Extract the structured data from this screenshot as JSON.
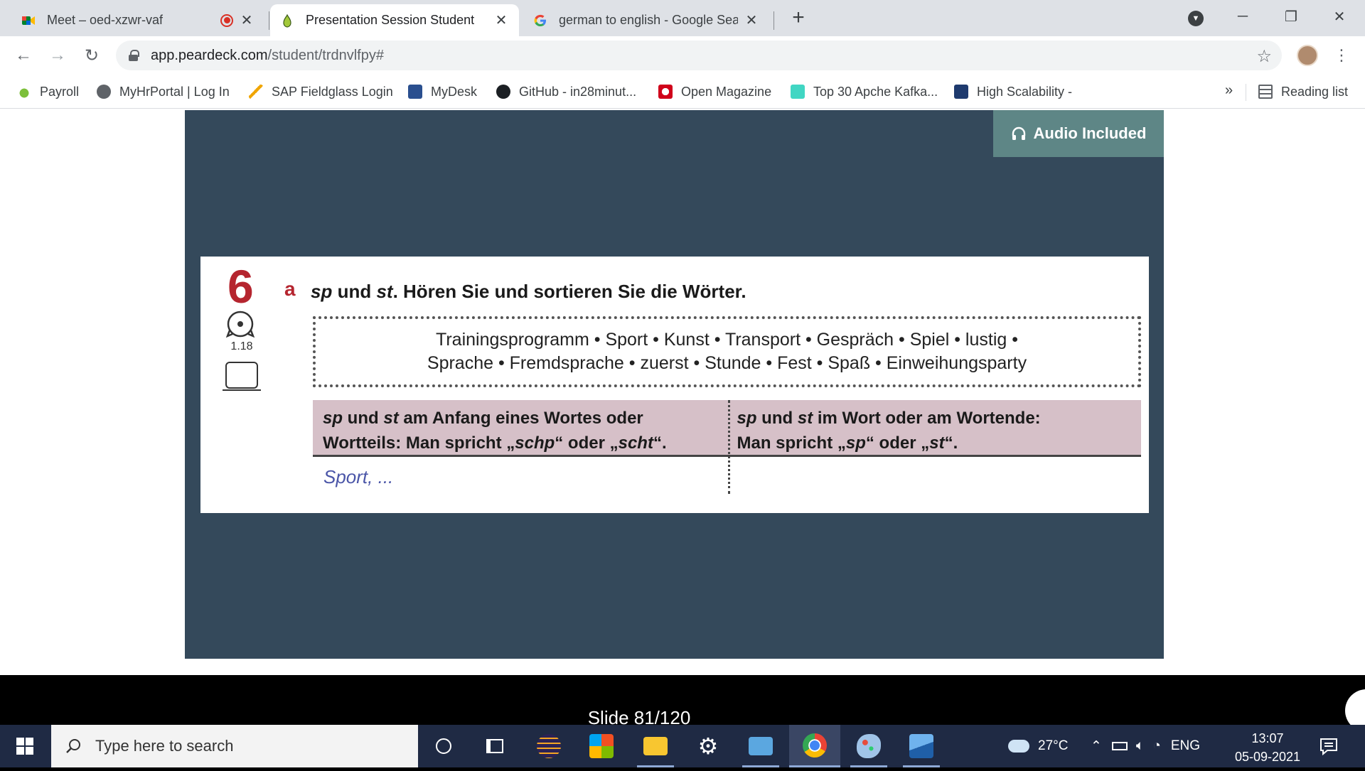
{
  "browser": {
    "tabs": [
      {
        "title": "Meet – oed-xzwr-vaf",
        "icon": "google-meet-icon",
        "recording": true
      },
      {
        "title": "Presentation Session Student",
        "icon": "peardeck-icon",
        "active": true
      },
      {
        "title": "german to english - Google Sear",
        "icon": "google-icon"
      }
    ],
    "new_tab_label": "+",
    "address": {
      "host": "app.peardeck.com",
      "path": "/student/trdnvlfpy#"
    },
    "bookmarks": [
      {
        "label": "Payroll",
        "icon": "payroll-icon"
      },
      {
        "label": "MyHrPortal | Log In",
        "icon": "globe-icon"
      },
      {
        "label": "SAP Fieldglass Login",
        "icon": "fieldglass-icon"
      },
      {
        "label": "MyDesk",
        "icon": "mydesk-icon"
      },
      {
        "label": "GitHub - in28minut...",
        "icon": "github-icon"
      },
      {
        "label": "Open Magazine",
        "icon": "open-magazine-icon"
      },
      {
        "label": "Top 30 Apche Kafka...",
        "icon": "kafka-icon"
      },
      {
        "label": "High Scalability -",
        "icon": "high-scalability-icon"
      }
    ],
    "bookmarks_overflow": "»",
    "reading_list": "Reading list"
  },
  "slide": {
    "audio_badge": "Audio Included",
    "exercise_number": "6",
    "track": "1.18",
    "exercise_letter": "a",
    "instruction": {
      "sp": "sp",
      "und": " und ",
      "st": "st",
      "rest": ". Hören Sie und sortieren Sie die Wörter."
    },
    "words_line1": "Trainingsprogramm • Sport • Kunst • Transport • Gespräch • Spiel • lustig •",
    "words_line2": "Sprache • Fremdsprache • zuerst • Stunde • Fest • Spaß • Einweihungsparty",
    "col1": {
      "sp": "sp",
      "und": " und ",
      "st": "st",
      "line1": " am Anfang eines Wortes oder",
      "line2_a": "Wortteils: Man spricht „",
      "schp": "schp",
      "oder": "“ oder „",
      "scht": "scht",
      "end": "“."
    },
    "col2": {
      "sp": "sp",
      "und": " und ",
      "st": "st",
      "line1": " im Wort oder am Wortende:",
      "line2_a": "Man spricht „",
      "sp2": "sp",
      "oder": "“ oder „",
      "st2": "st",
      "end": "“."
    },
    "answer": "Sport, ...",
    "counter": "Slide 81/120"
  },
  "taskbar": {
    "search_placeholder": "Type here to search",
    "weather": "27°C",
    "language": "ENG",
    "time": "13:07",
    "date": "05-09-2021",
    "apps": [
      "cortana-icon",
      "task-view-icon",
      "eclipse-icon",
      "store-icon",
      "file-explorer-icon",
      "settings-icon",
      "control-panel-icon",
      "chrome-icon",
      "paint-icon",
      "photos-icon"
    ]
  },
  "colors": {
    "slide_bg": "#34495b",
    "accent_red": "#b5252f",
    "table_header": "#d6c0c8",
    "answer_blue": "#4b56a8",
    "badge": "#5e8686"
  }
}
